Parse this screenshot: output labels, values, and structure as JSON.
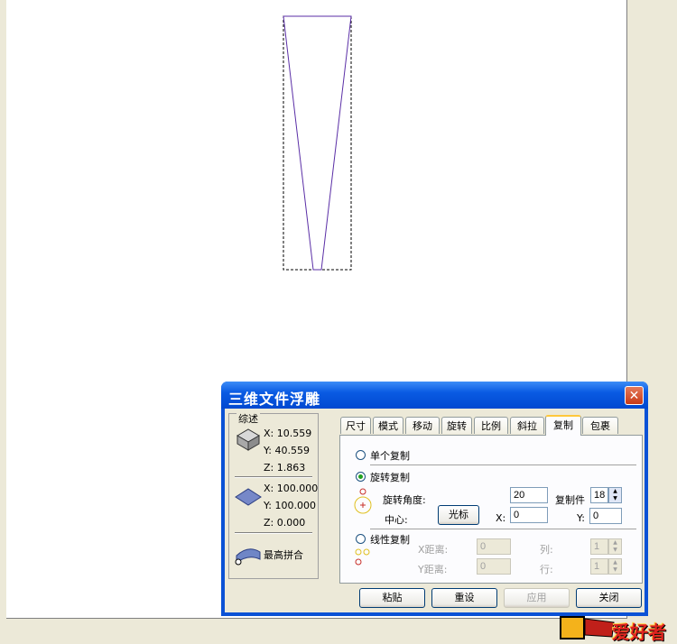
{
  "dialog": {
    "title": "三维文件浮雕",
    "close_glyph": "✕"
  },
  "summary": {
    "group_label": "综述",
    "size_x": "X:  10.559",
    "size_y": "Y:  40.559",
    "size_z": "Z:  1.863",
    "plane_x": "X:  100.000",
    "plane_y": "Y:  100.000",
    "plane_z": "Z:  0.000",
    "fit_label": "最高拼合"
  },
  "tabs": [
    "尺寸",
    "模式",
    "移动",
    "旋转",
    "比例",
    "斜拉",
    "复制",
    "包裹"
  ],
  "copy_tab": {
    "single_copy": "单个复制",
    "rotate_copy": "旋转复制",
    "rotate_angle_label": "旋转角度:",
    "rotate_angle_value": "20",
    "copies_label": "复制件",
    "copies_value": "18",
    "center_label": "中心:",
    "cursor_button": "光标",
    "x_label": "X:",
    "x_value": "0",
    "y_label": "Y:",
    "y_value": "0",
    "linear_copy": "线性复制",
    "x_distance_label": "X距离:",
    "x_distance_value": "0",
    "y_distance_label": "Y距离:",
    "y_distance_value": "0",
    "column_label": "列:",
    "column_value": "1",
    "row_label": "行:",
    "row_value": "1"
  },
  "buttons": {
    "paste": "粘贴",
    "reset": "重设",
    "apply": "应用",
    "close": "关闭"
  },
  "watermark": {
    "text": "爱好者"
  },
  "icon_names": [
    "box-3d-icon",
    "plane-icon",
    "fit-icon",
    "rotate-center-icon",
    "linear-copy-icon",
    "close-icon",
    "spin-up-icon",
    "spin-down-icon"
  ],
  "colors": {
    "titlebar": "#0a5be3",
    "shape_stroke": "#5a2ea6",
    "close_button": "#c93a17"
  }
}
